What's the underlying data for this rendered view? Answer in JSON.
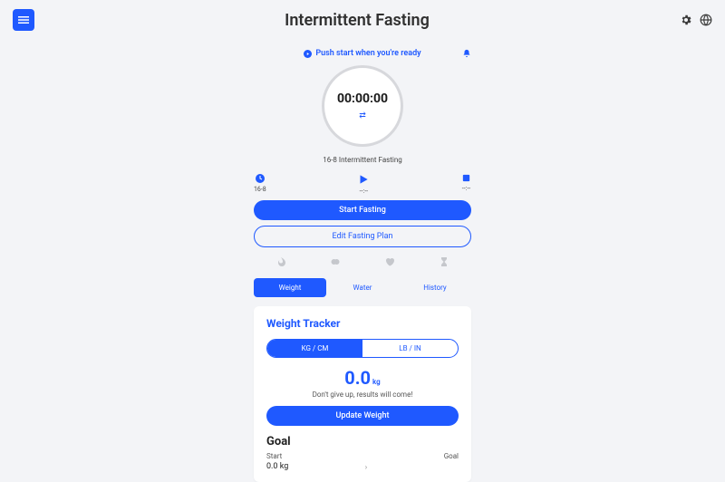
{
  "header": {
    "title": "Intermittent Fasting"
  },
  "status": {
    "text": "Push start when you're ready"
  },
  "timer": {
    "value": "00:00:00",
    "plan": "16-8 Intermittent Fasting"
  },
  "controls": {
    "left_label": "16-8",
    "mid_label": "--:--",
    "right_label": "--:--"
  },
  "buttons": {
    "start": "Start Fasting",
    "edit": "Edit Fasting Plan",
    "update_weight": "Update Weight"
  },
  "tabs": {
    "weight": "Weight",
    "water": "Water",
    "history": "History"
  },
  "weight_tracker": {
    "title": "Weight Tracker",
    "unit_kg": "KG / CM",
    "unit_lb": "LB / IN",
    "value": "0.0",
    "unit": "kg",
    "motivation": "Don't give up, results will come!"
  },
  "goal": {
    "heading": "Goal",
    "start_label": "Start",
    "start_value": "0.0 kg",
    "goal_label": "Goal"
  }
}
